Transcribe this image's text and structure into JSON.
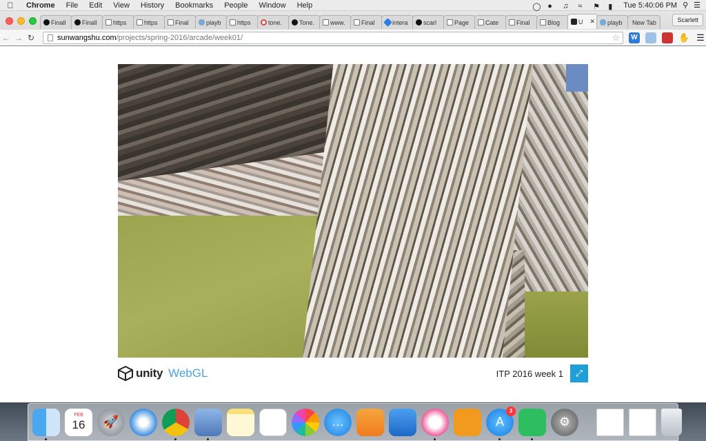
{
  "menubar": {
    "app_name": "Chrome",
    "items": [
      "File",
      "Edit",
      "View",
      "History",
      "Bookmarks",
      "People",
      "Window",
      "Help"
    ],
    "clock": "Tue 5:40:06 PM"
  },
  "browser": {
    "tabs": [
      {
        "label": "Finall",
        "icon": "github-icon"
      },
      {
        "label": "Finall",
        "icon": "github-icon"
      },
      {
        "label": "https",
        "icon": "page-icon"
      },
      {
        "label": "https",
        "icon": "page-icon"
      },
      {
        "label": "Final",
        "icon": "page-icon"
      },
      {
        "label": "playb",
        "icon": "cloud-icon"
      },
      {
        "label": "https",
        "icon": "page-icon"
      },
      {
        "label": "tone.",
        "icon": "google-icon"
      },
      {
        "label": "Tone.",
        "icon": "github-icon"
      },
      {
        "label": "www.",
        "icon": "page-icon"
      },
      {
        "label": "Final",
        "icon": "page-icon"
      },
      {
        "label": "intera",
        "icon": "dropbox-icon"
      },
      {
        "label": "scarl",
        "icon": "github-icon"
      },
      {
        "label": "Page",
        "icon": "page-icon"
      },
      {
        "label": "Cate",
        "icon": "page-icon"
      },
      {
        "label": "Final",
        "icon": "page-icon"
      },
      {
        "label": "Blog",
        "icon": "page-icon"
      },
      {
        "label": "U",
        "icon": "unity-icon",
        "active": true
      },
      {
        "label": "playb",
        "icon": "cloud-icon"
      },
      {
        "label": "New Tab",
        "icon": ""
      }
    ],
    "profile_name": "Scarlett",
    "url_host": "sunwangshu.com",
    "url_path": "/projects/spring-2016/arcade/week01/"
  },
  "page": {
    "brand_unity": "unity",
    "brand_webgl": "WebGL",
    "game_title": "ITP 2016 week 1"
  },
  "dock": {
    "calendar_month": "FEB",
    "calendar_day": "16",
    "appstore_badge": "3"
  },
  "colors": {
    "accent": "#1f9fd8",
    "webgl_blue": "#4aa3d6"
  }
}
